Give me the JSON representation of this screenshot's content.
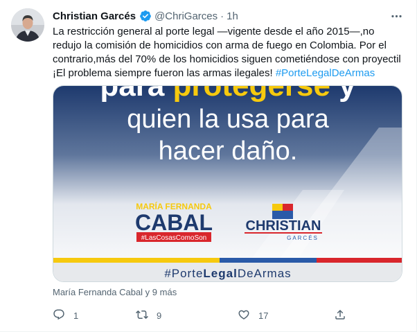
{
  "author": {
    "name": "Christian Garcés",
    "handle": "@ChriGarces",
    "separator": "·",
    "time": "1h"
  },
  "tweet_text": {
    "line1": "La restricción general al porte legal —vigente desde el año 2015—,no",
    "line2": "redujo la comisión de homicidios con arma de fuego en Colombia. Por el",
    "line3": "contrario,más del 70% de los homicidios siguen cometiéndose con proyectil",
    "line4_text": "¡El problema siempre fueron las armas ilegales! ",
    "hashtag": "#PorteLegalDeArmas"
  },
  "media_image": {
    "headline_line1": "para protegerse y",
    "headline_line1_a": "para ",
    "headline_line1_b": "protegerse",
    "headline_line1_c": " y",
    "headline_line2": "quien la usa para",
    "headline_line3": "hacer daño.",
    "logo_left_top": "MARÍA FERNANDA",
    "logo_left_main": "CABAL",
    "logo_left_tag": "#LasCosasComoSon",
    "logo_right_main": "CHRISTIAN",
    "logo_right_sub": "GARCÉS",
    "footer_hashtag": "#PorteLegalDeArmas",
    "footer_a": "#Porte",
    "footer_b": "Legal",
    "footer_c": "DeArmas",
    "colors": {
      "navy": "#1e3a6e",
      "yellow": "#f6c90e",
      "red": "#d9262c",
      "blue": "#2a5aa8",
      "footer_bg": "#e7e9ec"
    }
  },
  "tagged": "María Fernanda Cabal y 9 más",
  "actions": {
    "reply_count": "1",
    "retweet_count": "9",
    "like_count": "17"
  },
  "colors": {
    "accent": "#1d9bf0",
    "secondary_text": "#536471",
    "primary_text": "#0f1419"
  }
}
